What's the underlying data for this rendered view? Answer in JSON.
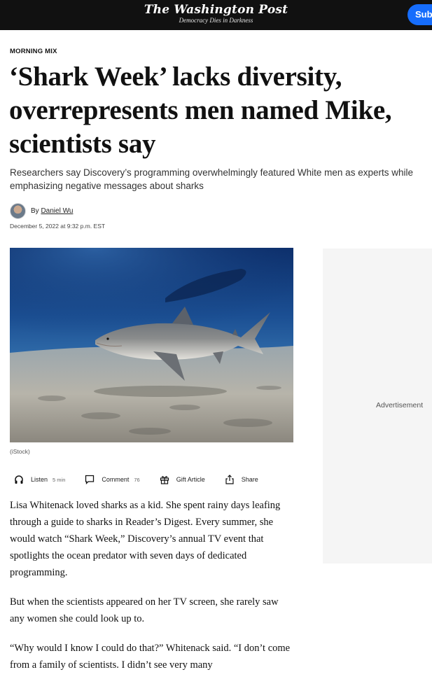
{
  "header": {
    "logo": "The Washington Post",
    "tagline": "Democracy Dies in Darkness",
    "subscribe_label": "Subscribe",
    "subscribe_color": "#166dfc",
    "bar_color": "#111111"
  },
  "article": {
    "kicker": "MORNING MIX",
    "headline": "‘Shark Week’ lacks diversity, overrepresents men named Mike, scientists say",
    "dek": "Researchers say Discovery’s programming overwhelmingly featured White men as experts while emphasizing negative messages about sharks",
    "byline_prefix": "By",
    "author": "Daniel Wu",
    "date": "December 5, 2022 at 9:32 p.m. EST",
    "image_caption": "(iStock)",
    "paragraphs": [
      "Lisa Whitenack loved sharks as a kid. She spent rainy days leafing through a guide to sharks in Reader’s Digest. Every summer, she would watch “Shark Week,” Discovery’s annual TV event that spotlights the ocean predator with seven days of dedicated programming.",
      "But when the scientists appeared on her TV screen, she rarely saw any women she could look up to.",
      "“Why would I know I could do that?” Whitenack said. “I don’t come from a family of scientists. I didn’t see very many"
    ]
  },
  "actions": {
    "listen_label": "Listen",
    "listen_duration": "5 min",
    "listen_icon": "headphones-icon",
    "comment_label": "Comment",
    "comment_count": "76",
    "comment_icon": "comment-icon",
    "gift_label": "Gift Article",
    "gift_icon": "gift-icon",
    "share_label": "Share",
    "share_icon": "share-icon"
  },
  "sidebar": {
    "ad_label": "Advertisement"
  }
}
